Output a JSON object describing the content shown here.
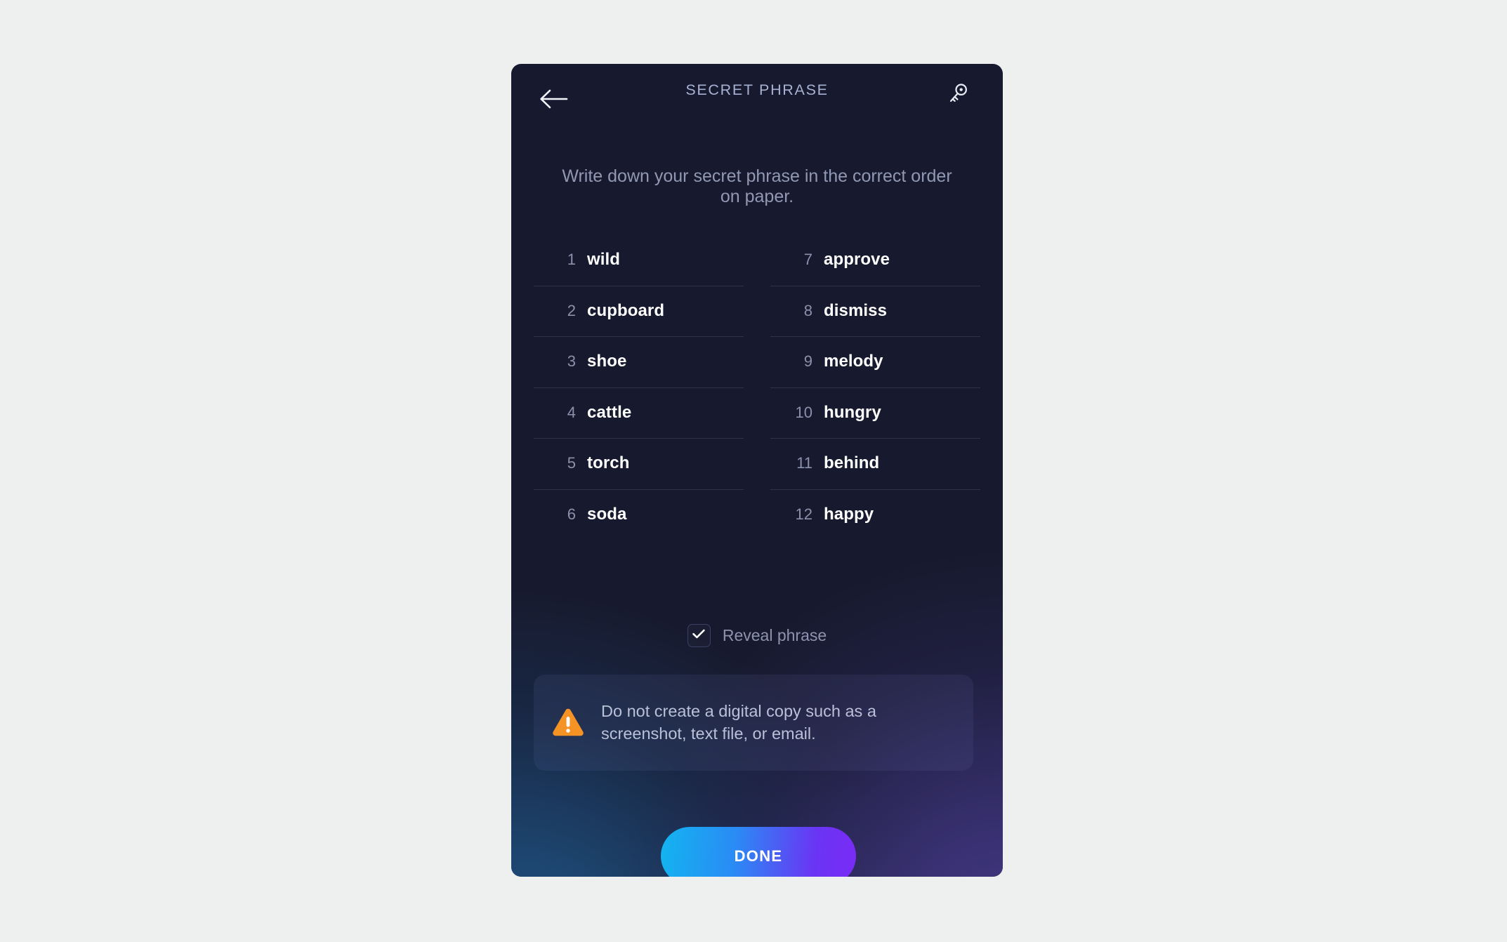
{
  "header": {
    "title": "SECRET PHRASE",
    "back_icon": "arrow-left-icon",
    "key_icon": "key-icon"
  },
  "subtitle": "Write down your secret phrase in the correct order on paper.",
  "phrase": {
    "left_column": [
      {
        "index": "1",
        "word": "wild"
      },
      {
        "index": "2",
        "word": "cupboard"
      },
      {
        "index": "3",
        "word": "shoe"
      },
      {
        "index": "4",
        "word": "cattle"
      },
      {
        "index": "5",
        "word": "torch"
      },
      {
        "index": "6",
        "word": "soda"
      }
    ],
    "right_column": [
      {
        "index": "7",
        "word": "approve"
      },
      {
        "index": "8",
        "word": "dismiss"
      },
      {
        "index": "9",
        "word": "melody"
      },
      {
        "index": "10",
        "word": "hungry"
      },
      {
        "index": "11",
        "word": "behind"
      },
      {
        "index": "12",
        "word": "happy"
      }
    ]
  },
  "reveal": {
    "label": "Reveal phrase",
    "checked": true,
    "check_icon": "checkmark-icon"
  },
  "warning": {
    "icon": "warning-triangle-icon",
    "text": "Do not create a digital copy such as a screenshot, text file, or email."
  },
  "done_button": {
    "label": "DONE"
  },
  "colors": {
    "page_background": "#eef0f0",
    "card_background": "#171a2e",
    "card_glow_left": "#1f5486",
    "card_glow_right": "#453a8c",
    "title": "#a7b1d2",
    "subtitle": "#9198b3",
    "word": "#ffffff",
    "word_index": "#8b91ad",
    "warning_icon": "#f59425",
    "warning_text": "#b9c0d8",
    "button_gradient_start": "#13b4f0",
    "button_gradient_end": "#7a2bf5"
  }
}
